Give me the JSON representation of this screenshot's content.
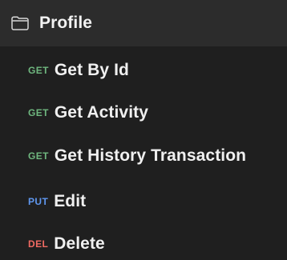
{
  "folder": {
    "title": "Profile",
    "icon": "folder-icon"
  },
  "colors": {
    "background": "#1f1f1f",
    "header_background": "#2c2c2c",
    "GET": "#6fb77f",
    "PUT": "#5f97ef",
    "DEL": "#f06a62",
    "text": "#f0f0f0"
  },
  "requests": [
    {
      "method": "GET",
      "name": "Get By Id"
    },
    {
      "method": "GET",
      "name": "Get Activity"
    },
    {
      "method": "GET",
      "name": "Get History Transaction"
    },
    {
      "method": "PUT",
      "name": "Edit"
    },
    {
      "method": "DEL",
      "name": "Delete"
    }
  ]
}
